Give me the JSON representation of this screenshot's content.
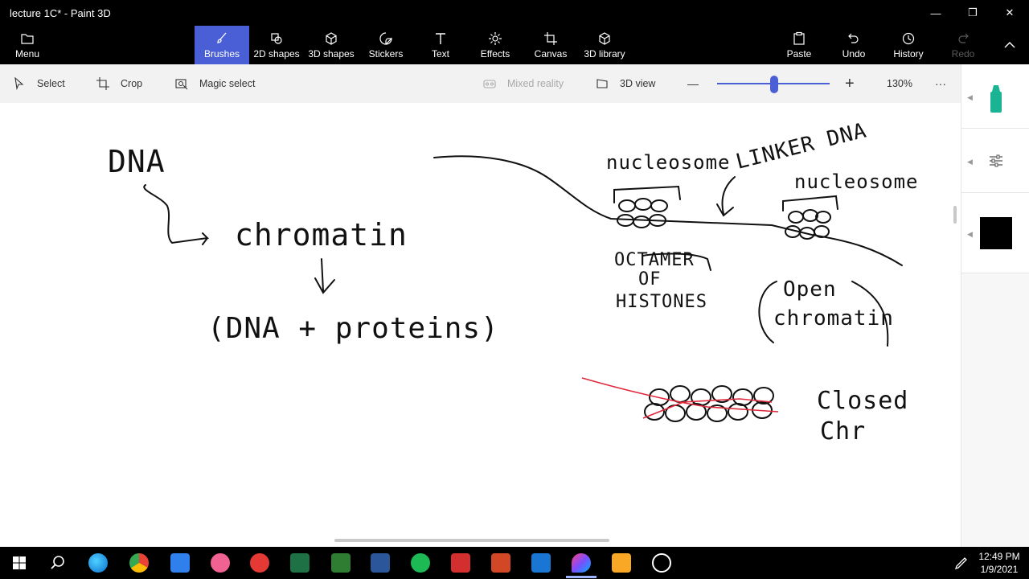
{
  "window": {
    "title": "lecture 1C* - Paint 3D",
    "minimize": "—",
    "restore": "❐",
    "close": "✕"
  },
  "ribbon": {
    "menu": "Menu",
    "brushes": "Brushes",
    "shapes2d": "2D shapes",
    "shapes3d": "3D shapes",
    "stickers": "Stickers",
    "text": "Text",
    "effects": "Effects",
    "canvas": "Canvas",
    "library3d": "3D library",
    "paste": "Paste",
    "undo": "Undo",
    "history": "History",
    "redo": "Redo",
    "accent": "#4a5fd6"
  },
  "commands": {
    "select": "Select",
    "crop": "Crop",
    "magic_select": "Magic select",
    "mixed_reality": "Mixed reality",
    "view3d": "3D view",
    "zoom_level": "130%",
    "zoom_minus": "—",
    "zoom_plus": "+",
    "more": "···"
  },
  "panel": {
    "brush_color": "#000000",
    "marker_color": "#1ab394"
  },
  "taskbar": {
    "time": "12:49 PM",
    "date": "1/9/2021",
    "icons": [
      "windows-start",
      "search",
      "edge",
      "chrome",
      "file-manager",
      "app-pink",
      "app-red",
      "excel",
      "app-green",
      "word",
      "spotify",
      "acrobat",
      "powerpoint",
      "photos",
      "paint3d",
      "file-explorer",
      "obs"
    ]
  },
  "drawing": {
    "dna": "DNA",
    "chromatin": "chromatin",
    "dna_proteins": "(DNA + proteins)",
    "nucleosome_1": "nucleosome",
    "nucleosome_2": "nucleosome",
    "linker_dna": "LINKER DNA",
    "octamer": "OCTAMER",
    "of": "OF",
    "histones": "HISTONES",
    "open": "Open",
    "open_chromatin": "chromatin",
    "closed": "Closed",
    "chr": "Chr"
  }
}
